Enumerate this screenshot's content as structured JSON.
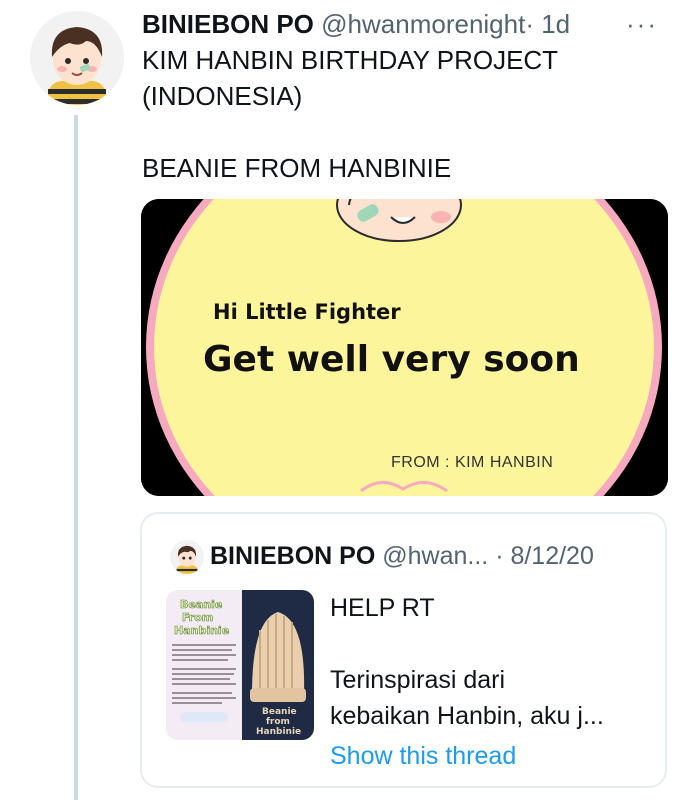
{
  "tweet": {
    "author_name": "BINIEBON PO",
    "handle": "@hwanmorenight",
    "time": "· 1d",
    "more_icon": "···",
    "text": "KIM HANBIN BIRTHDAY PROJECT\n(INDONESIA)\n\nBEANIE FROM HANBINIE"
  },
  "media_card": {
    "subtitle": "Hi Little Fighter",
    "title": "Get well very soon",
    "from": "FROM : KIM HANBIN",
    "colors": {
      "background": "#fdf59c",
      "ring": "#f7a9c0",
      "outer": "#000000"
    }
  },
  "quoted": {
    "author_name": "BINIEBON PO",
    "handle": "@hwan...",
    "time": "· 8/12/20",
    "lines": [
      "HELP RT",
      "",
      "Terinspirasi dari",
      "kebaikan Hanbin, aku j..."
    ],
    "link": "Show this thread",
    "thumb_title": [
      "Beanie",
      "From",
      "Hanbinie"
    ],
    "thumb_sub": [
      "Beanie",
      "from",
      "Hanbinie"
    ]
  },
  "colors": {
    "link": "#1d9bf0",
    "secondary": "#536471",
    "line": "#cfd9de"
  }
}
